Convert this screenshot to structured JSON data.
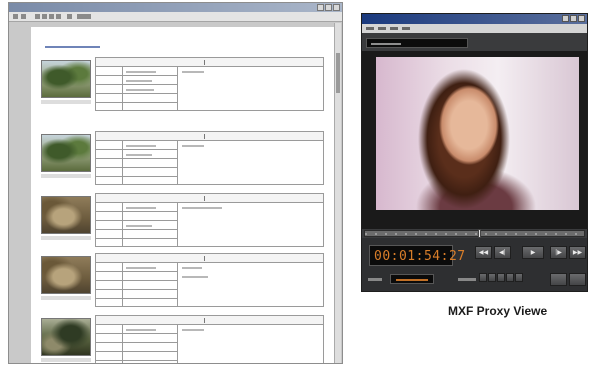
{
  "caption": "MXF Proxy Viewe",
  "player": {
    "timecode": "00:01:54:27"
  },
  "icons": {
    "transport": [
      "rewind-to-start-icon",
      "step-back-icon",
      "play-icon",
      "step-forward-icon",
      "fast-forward-to-end-icon"
    ]
  },
  "colors": {
    "timecode": "#d97e2a",
    "player_body": "#3a3b3d",
    "doc_heading": "#4a5c8c"
  }
}
